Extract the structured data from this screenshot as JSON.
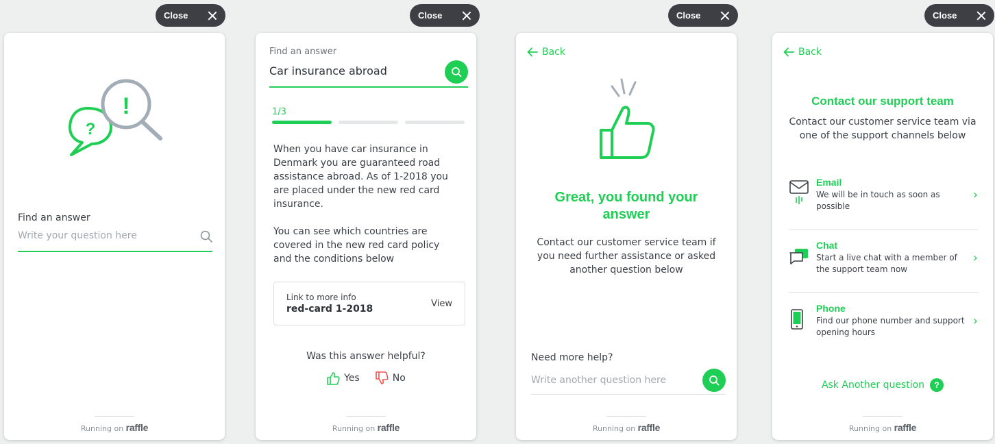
{
  "colors": {
    "accent": "#1fcf55",
    "close_bg": "#3d3f44",
    "dislike": "#f0504f"
  },
  "close_label": "Close",
  "footer": {
    "prefix": "Running on",
    "brand": "raffle"
  },
  "panel1": {
    "label": "Find an answer",
    "placeholder": "Write your question here"
  },
  "panel2": {
    "label": "Find an answer",
    "query": "Car insurance abroad",
    "step": "1/3",
    "paragraph1": "When you have car insurance in Denmark you are guaranteed road assistance abroad. As of 1-2018 you are placed under the new red card insurance.",
    "paragraph2": "You can see which countries are covered in the new red card policy and the conditions below",
    "link_caption": "Link to more info",
    "link_title": "red-card 1-2018",
    "link_action": "View",
    "helpful_question": "Was this answer helpful?",
    "yes_label": "Yes",
    "no_label": "No"
  },
  "panel3": {
    "back_label": "Back",
    "title": "Great, you found your answer",
    "subtitle": "Contact our customer service team if you need further assistance or asked another question below",
    "more_help": "Need more help?",
    "placeholder": "Write another question here"
  },
  "panel4": {
    "back_label": "Back",
    "title": "Contact our support team",
    "subtitle": "Contact our customer service team via one of the support channels below",
    "channels": [
      {
        "name": "Email",
        "desc": "We will be in touch as soon as possible",
        "icon": "envelope-icon"
      },
      {
        "name": "Chat",
        "desc": "Start a live chat with a member of the support team now",
        "icon": "chat-bubble-icon"
      },
      {
        "name": "Phone",
        "desc": "Find our phone number and support opening hours",
        "icon": "phone-icon"
      }
    ],
    "ask_label": "Ask Another question",
    "ask_badge": "?"
  }
}
